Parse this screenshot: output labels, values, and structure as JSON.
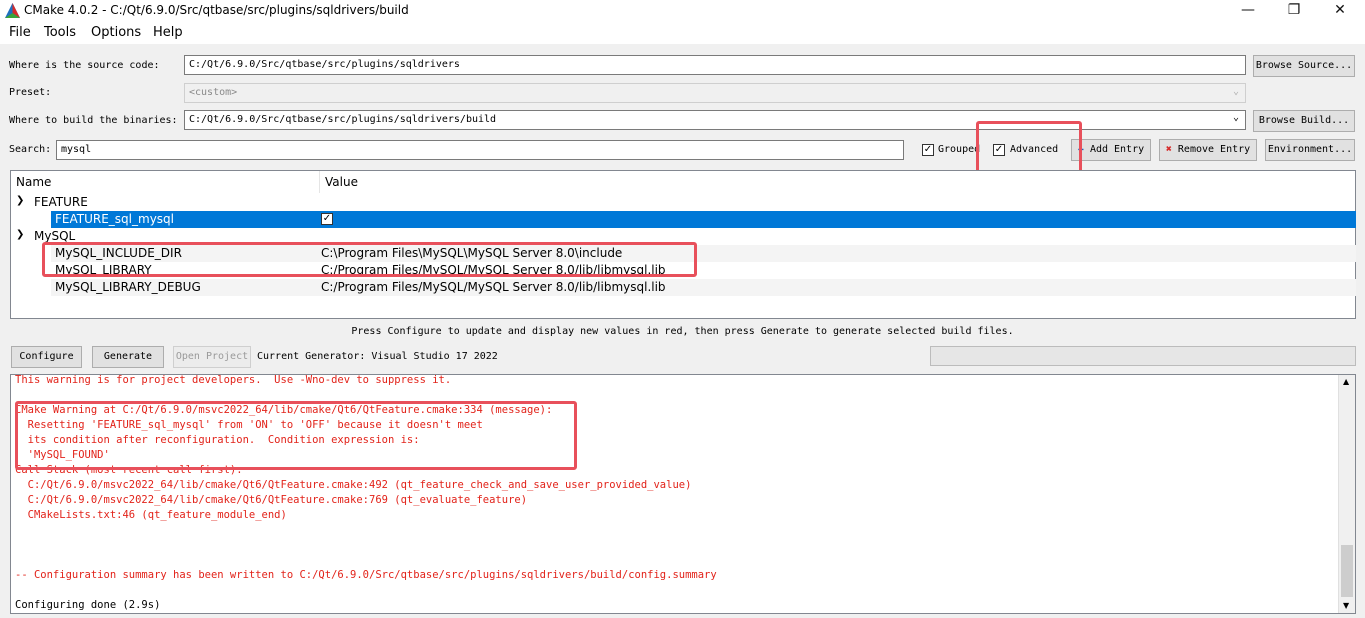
{
  "window": {
    "title": "CMake 4.0.2 - C:/Qt/6.9.0/Src/qtbase/src/plugins/sqldrivers/build",
    "minimize": "—",
    "maximize": "❐",
    "close": "✕"
  },
  "menu": [
    "File",
    "Tools",
    "Options",
    "Help"
  ],
  "source": {
    "label": "Where is the source code:",
    "value": "C:/Qt/6.9.0/Src/qtbase/src/plugins/sqldrivers",
    "button": "Browse Source..."
  },
  "preset": {
    "label": "Preset:",
    "value": "<custom>"
  },
  "build": {
    "label": "Where to build the binaries:",
    "value": "C:/Qt/6.9.0/Src/qtbase/src/plugins/sqldrivers/build",
    "button": "Browse Build..."
  },
  "search": {
    "label": "Search:",
    "value": "mysql"
  },
  "options": {
    "grouped": {
      "label": "Grouped",
      "checked": true
    },
    "advanced": {
      "label": "Advanced",
      "checked": true
    },
    "add_entry": "Add Entry",
    "remove_entry": "Remove Entry",
    "environment": "Environment..."
  },
  "table": {
    "columns": [
      "Name",
      "Value"
    ],
    "groups": [
      {
        "name": "FEATURE",
        "entries": [
          {
            "name": "FEATURE_sql_mysql",
            "value": "✓",
            "selected": true
          }
        ]
      },
      {
        "name": "MySQL",
        "entries": [
          {
            "name": "MySQL_INCLUDE_DIR",
            "value": "C:\\Program Files\\MySQL\\MySQL Server 8.0\\include"
          },
          {
            "name": "MySQL_LIBRARY",
            "value": "C:/Program Files/MySQL/MySQL Server 8.0/lib/libmysql.lib"
          },
          {
            "name": "MySQL_LIBRARY_DEBUG",
            "value": "C:/Program Files/MySQL/MySQL Server 8.0/lib/libmysql.lib"
          }
        ]
      }
    ]
  },
  "hint": "Press Configure to update and display new values in red, then press Generate to generate selected build files.",
  "actions": {
    "configure": "Configure",
    "generate": "Generate",
    "open_project": "Open Project",
    "generator": "Current Generator: Visual Studio 17 2022"
  },
  "log": [
    {
      "text": "This warning is for project developers.  Use -Wno-dev to suppress it.",
      "color": "red"
    },
    {
      "text": "",
      "color": "red"
    },
    {
      "text": "CMake Warning at C:/Qt/6.9.0/msvc2022_64/lib/cmake/Qt6/QtFeature.cmake:334 (message):",
      "color": "red"
    },
    {
      "text": "  Resetting 'FEATURE_sql_mysql' from 'ON' to 'OFF' because it doesn't meet",
      "color": "red"
    },
    {
      "text": "  its condition after reconfiguration.  Condition expression is:",
      "color": "red"
    },
    {
      "text": "  'MySQL_FOUND'",
      "color": "red"
    },
    {
      "text": "Call Stack (most recent call first):",
      "color": "red"
    },
    {
      "text": "  C:/Qt/6.9.0/msvc2022_64/lib/cmake/Qt6/QtFeature.cmake:492 (qt_feature_check_and_save_user_provided_value)",
      "color": "red"
    },
    {
      "text": "  C:/Qt/6.9.0/msvc2022_64/lib/cmake/Qt6/QtFeature.cmake:769 (qt_evaluate_feature)",
      "color": "red"
    },
    {
      "text": "  CMakeLists.txt:46 (qt_feature_module_end)",
      "color": "red"
    },
    {
      "text": "",
      "color": "red"
    },
    {
      "text": "",
      "color": "red"
    },
    {
      "text": "",
      "color": "red"
    },
    {
      "text": "-- Configuration summary has been written to C:/Qt/6.9.0/Src/qtbase/src/plugins/sqldrivers/build/config.summary",
      "color": "red"
    },
    {
      "text": "",
      "color": "red"
    },
    {
      "text": "Configuring done (2.9s)",
      "color": "black"
    }
  ],
  "colors": {
    "selection": "#0078d7",
    "highlight_box": "#e8505b",
    "log_red": "#e2231a"
  }
}
